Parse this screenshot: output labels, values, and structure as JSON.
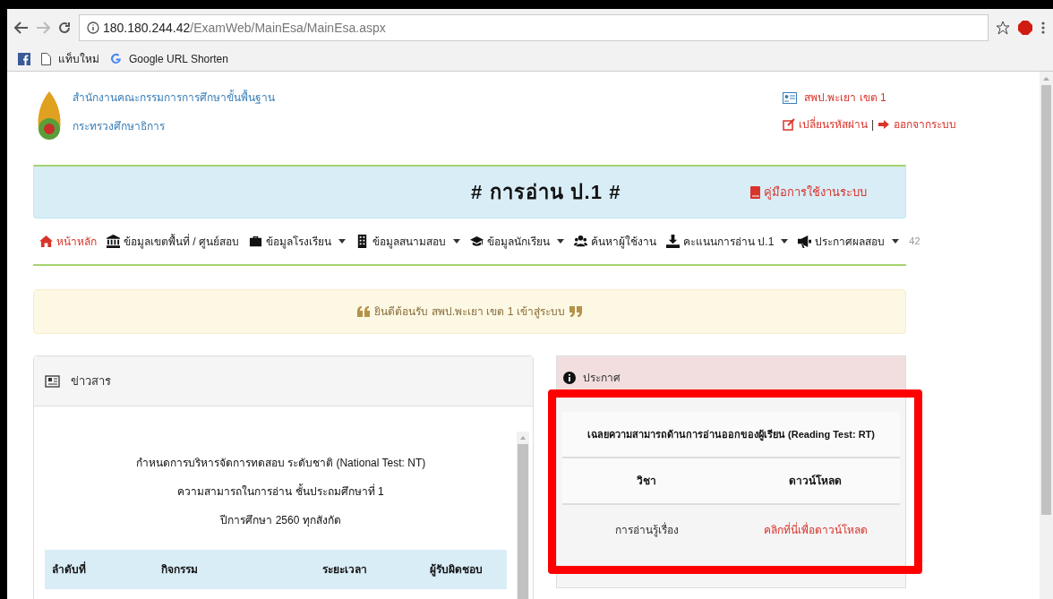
{
  "browser": {
    "url_host": "180.180.244.42",
    "url_path": "/ExamWeb/MainEsa/MainEsa.aspx",
    "bookmarks": [
      {
        "kind": "facebook"
      },
      {
        "kind": "page",
        "label": "แท็บใหม่"
      },
      {
        "kind": "google",
        "label": "Google URL Shorten"
      }
    ]
  },
  "header": {
    "org_lines": [
      "สำนักงานคณะกรรมการการศึกษาขั้นพื้นฐาน",
      "กระทรวงศึกษาธิการ"
    ],
    "user": "สพป.พะเยา เขต 1",
    "change_password": "เปลี่ยนรหัสผ่าน",
    "separator": "|",
    "logout": "ออกจากระบบ"
  },
  "banner": {
    "title": "# การอ่าน ป.1 #",
    "manual_link": "คู่มือการใช้งานระบบ"
  },
  "nav": {
    "items": [
      {
        "label": "หน้าหลัก",
        "selected": true,
        "dropdown": false
      },
      {
        "label": "ข้อมูลเขตพื้นที่ / ศูนย์สอบ",
        "selected": false,
        "dropdown": false
      },
      {
        "label": "ข้อมูลโรงเรียน",
        "selected": false,
        "dropdown": true
      },
      {
        "label": "ข้อมูลสนามสอบ",
        "selected": false,
        "dropdown": true
      },
      {
        "label": "ข้อมูลนักเรียน",
        "selected": false,
        "dropdown": true
      },
      {
        "label": "ค้นหาผู้ใช้งาน",
        "selected": false,
        "dropdown": false
      },
      {
        "label": "คะแนนการอ่าน ป.1",
        "selected": false,
        "dropdown": true
      },
      {
        "label": "ประกาศผลสอบ",
        "selected": false,
        "dropdown": true
      }
    ],
    "counter": "42"
  },
  "welcome": "ยินดีต้อนรับ สพป.พะเยา เขต 1 เข้าสู่ระบบ",
  "news": {
    "title": "ข่าวสาร",
    "lines": [
      "กำหนดการบริหารจัดการทดสอบ ระดับชาติ (National Test: NT)",
      "ความสามารถในการอ่าน ชั้นประถมศึกษาที่ 1",
      "ปีการศึกษา 2560 ทุกสังกัด"
    ],
    "columns": [
      "ลำดับที่",
      "กิจกรรม",
      "ระยะเวลา",
      "ผู้รับผิดชอบ"
    ]
  },
  "announcement": {
    "title": "ประกาศ",
    "table_title": "เฉลยความสามารถด้านการอ่านออกของผู้เรียน (Reading Test: RT)",
    "columns": [
      "วิชา",
      "ดาวน์โหลด"
    ],
    "rows": [
      {
        "subject": "การอ่านรู้เรื่อง",
        "link": "คลิกที่นี่เพื่อดาวน์โหลด"
      }
    ]
  }
}
